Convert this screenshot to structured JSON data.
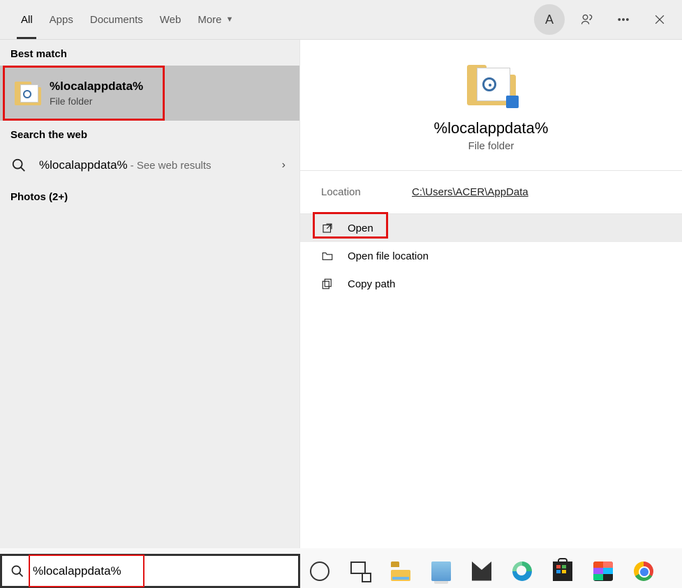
{
  "topbar": {
    "tabs": {
      "all": "All",
      "apps": "Apps",
      "docs": "Documents",
      "web": "Web",
      "more": "More"
    },
    "avatar_initial": "A"
  },
  "left": {
    "best_match_header": "Best match",
    "best_match": {
      "title": "%localappdata%",
      "subtitle": "File folder"
    },
    "search_web_header": "Search the web",
    "web_result": {
      "query": "%localappdata%",
      "suffix": " - See web results"
    },
    "photos_header": "Photos (2+)"
  },
  "right": {
    "title": "%localappdata%",
    "subtitle": "File folder",
    "location_label": "Location",
    "location_value": "C:\\Users\\ACER\\AppData",
    "actions": {
      "open": "Open",
      "open_file_location": "Open file location",
      "copy_path": "Copy path"
    }
  },
  "search": {
    "value": "%localappdata%"
  }
}
